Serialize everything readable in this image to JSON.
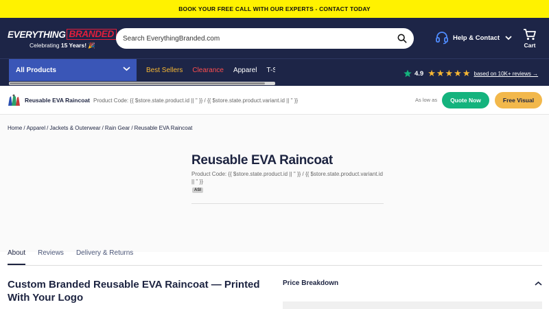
{
  "announcement": "BOOK YOUR FREE CALL WITH OUR EXPERTS - CONTACT TODAY",
  "logo": {
    "word1": "EVERYTHING",
    "word2": "BRANDED",
    "tagline_pre": "Celebrating",
    "tagline_bold": "15 Years!",
    "tagline_emoji": "🎉"
  },
  "search": {
    "placeholder": "Search EverythingBranded.com"
  },
  "help": {
    "label": "Help & Contact"
  },
  "cart": {
    "label": "Cart"
  },
  "nav": {
    "all_products": "All Products",
    "links": [
      "Best Sellers",
      "Clearance",
      "Apparel",
      "T-Shirts"
    ]
  },
  "rating": {
    "score": "4.9",
    "stars": "★★★★★",
    "reviews": "based on 10K+ reviews →"
  },
  "sticky": {
    "product_name": "Reusable EVA Raincoat",
    "product_code": "Product Code: {{ $store.state.product.id || '' }} / {{ $store.state.product.variant.id || '' }}",
    "as_low_as": "As low as",
    "quote_button": "Quote Now",
    "visual_button": "Free Visual"
  },
  "breadcrumb": [
    "Home",
    "Apparel",
    "Jackets & Outerwear",
    "Rain Gear",
    "Reusable EVA Raincoat"
  ],
  "product": {
    "title": "Reusable EVA Raincoat",
    "code": "Product Code: {{ $store.state.product.id || '' }} / {{ $store.state.product.variant.id || '' }}",
    "badge": "ASI"
  },
  "tabs": [
    "About",
    "Reviews",
    "Delivery & Returns"
  ],
  "about_heading": "Custom Branded Reusable EVA Raincoat — Printed With Your Logo",
  "price_breakdown": "Price Breakdown",
  "colors": {
    "announcement_bg": "#fff200",
    "header_bg": "#1d2547",
    "all_products_bg": "#3a56b7",
    "quote_green": "#14b37d",
    "visual_gold": "#f2b84b",
    "best_sellers": "#f7b733",
    "clearance": "#ff4e4e",
    "brand_red": "#e31e3b"
  }
}
